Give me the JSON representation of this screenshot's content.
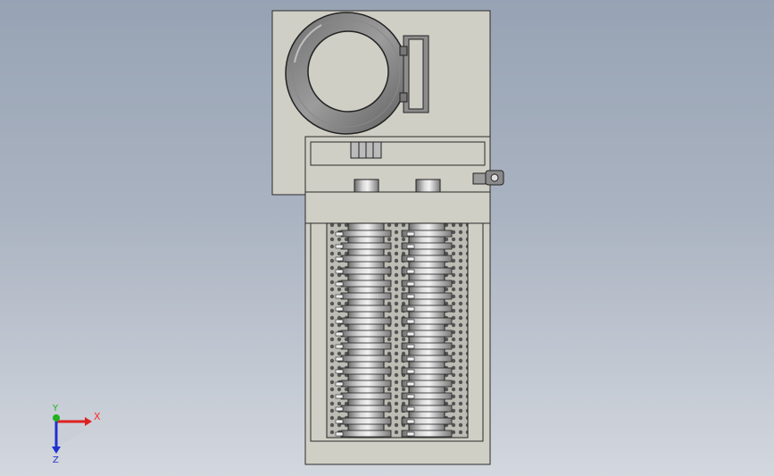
{
  "view": {
    "triad": {
      "x_label": "X",
      "y_label": "Y",
      "z_label": "Z"
    },
    "colors": {
      "background_top": "#97a3b4",
      "background_bottom": "#d3d7de",
      "housing": "#cfcfc5",
      "edge": "#2b2b2b",
      "steel": "#9a9a9a",
      "x_axis": "#e02020",
      "y_axis": "#20b020",
      "z_axis": "#2030d0"
    }
  }
}
